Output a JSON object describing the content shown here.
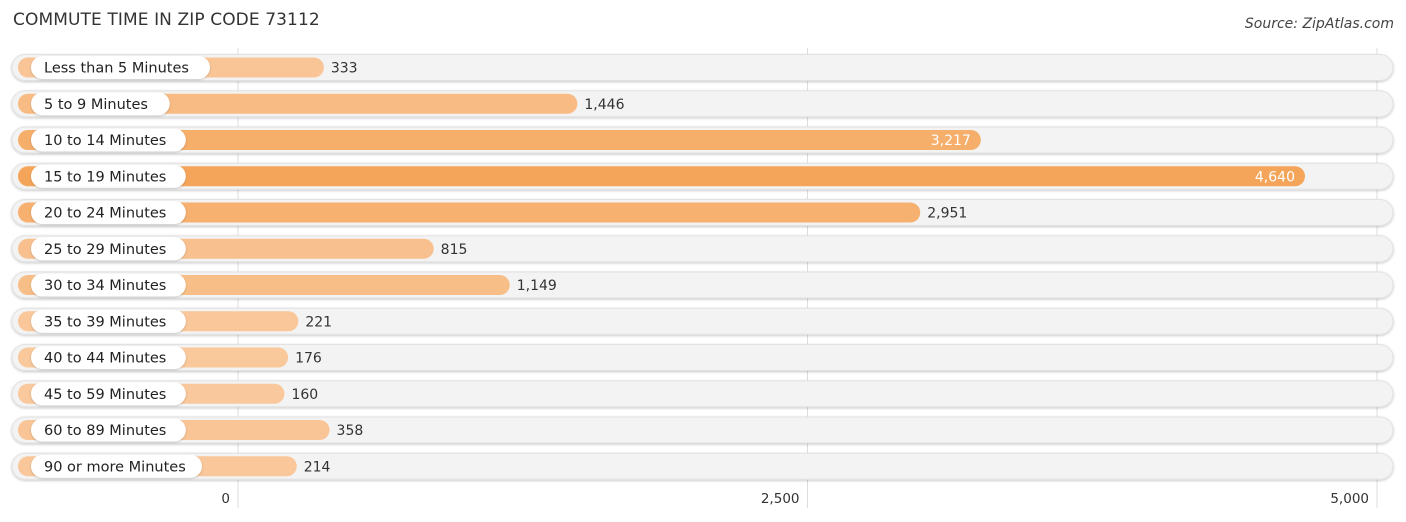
{
  "chart_data": {
    "type": "bar",
    "orientation": "horizontal",
    "title": "COMMUTE TIME IN ZIP CODE 73112",
    "source": "Source: ZipAtlas.com",
    "categories": [
      "Less than 5 Minutes",
      "5 to 9 Minutes",
      "10 to 14 Minutes",
      "15 to 19 Minutes",
      "20 to 24 Minutes",
      "25 to 29 Minutes",
      "30 to 34 Minutes",
      "35 to 39 Minutes",
      "40 to 44 Minutes",
      "45 to 59 Minutes",
      "60 to 89 Minutes",
      "90 or more Minutes"
    ],
    "values": [
      333,
      1446,
      3217,
      4640,
      2951,
      815,
      1149,
      221,
      176,
      160,
      358,
      214
    ],
    "value_labels": [
      "333",
      "1,446",
      "3,217",
      "4,640",
      "2,951",
      "815",
      "1,149",
      "221",
      "176",
      "160",
      "358",
      "214"
    ],
    "xlim": [
      0,
      5000
    ],
    "xticks": [
      0,
      2500,
      5000
    ],
    "xtick_labels": [
      "0",
      "2,500",
      "5,000"
    ],
    "xlabel": "",
    "ylabel": "",
    "grid": true,
    "legend": "none",
    "colors": {
      "bar_max": "#f5a55a",
      "bar_min": "#f9c89c",
      "track": "#f3f3f3",
      "grid": "#dddddd"
    }
  }
}
